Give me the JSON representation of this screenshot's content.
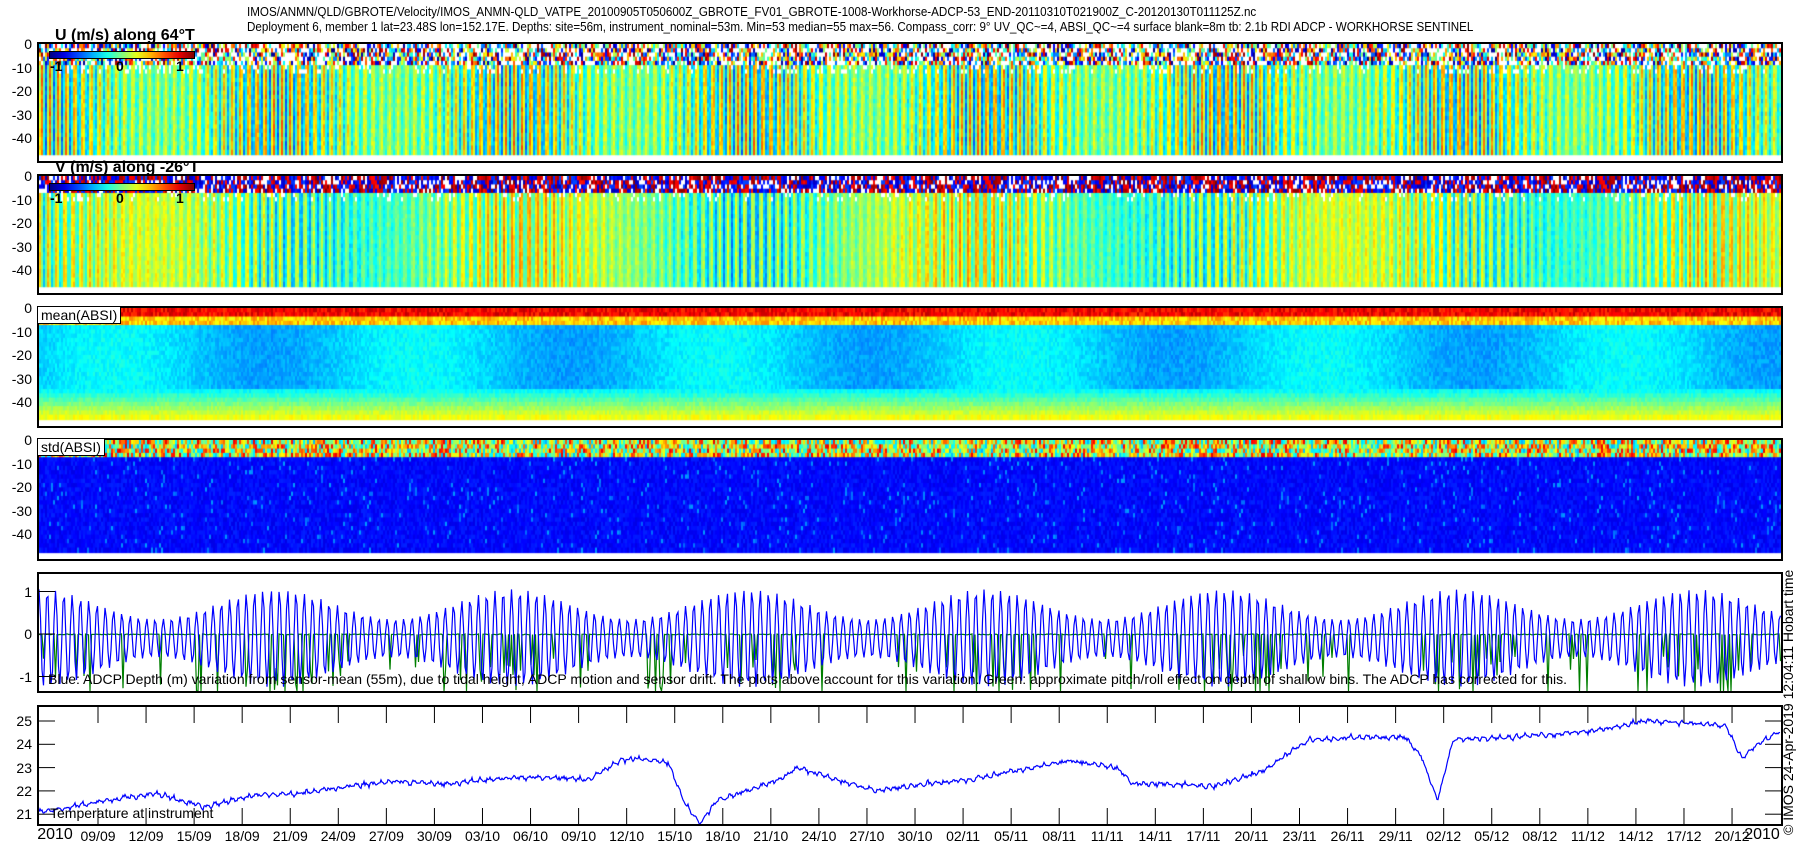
{
  "title": {
    "line1": "IMOS/ANMN/QLD/GBROTE/Velocity/IMOS_ANMN-QLD_VATPE_20100905T050600Z_GBROTE_FV01_GBROTE-1008-Workhorse-ADCP-53_END-20110310T021900Z_C-20120130T011125Z.nc",
    "line2": "Deployment 6, member 1 lat=23.48S lon=152.17E. Depths: site=56m, instrument_nominal=53m. Min=53 median=55 max=56. Compass_corr: 9° UV_QC~=4, ABSI_QC~=4 surface blank=8m tb: 2.1b RDI ADCP - WORKHORSE SENTINEL"
  },
  "panels": {
    "u": {
      "label": "U (m/s) along 64°T",
      "colorbar_ticks": [
        "-1",
        "0",
        "1"
      ]
    },
    "v": {
      "label": "V (m/s) along -26°T",
      "colorbar_ticks": [
        "-1",
        "0",
        "1"
      ]
    },
    "mean": {
      "label": "mean(ABSI)"
    },
    "std": {
      "label": "std(ABSI)"
    },
    "depth_caption": "Blue: ADCP Depth (m) variation from sensor-mean (55m), due to tidal height, ADCP motion and sensor drift. The plots above account for this variation. Green: approximate pitch/roll effect on depth of shallow bins. The ADCP has corrected for this.",
    "temp_caption": "Temperature at instrument"
  },
  "depth_ticks": [
    "0",
    "-10",
    "-20",
    "-30",
    "-40"
  ],
  "depth_var_ticks": [
    "1",
    "0",
    "-1"
  ],
  "temp_ticks": [
    "25",
    "24",
    "23",
    "22",
    "21"
  ],
  "x_axis": {
    "year_left": "2010",
    "year_right": "2010",
    "ticks": [
      "09/09",
      "12/09",
      "15/09",
      "18/09",
      "21/09",
      "24/09",
      "27/09",
      "30/09",
      "03/10",
      "06/10",
      "09/10",
      "12/10",
      "15/10",
      "18/10",
      "21/10",
      "24/10",
      "27/10",
      "30/10",
      "02/11",
      "05/11",
      "08/11",
      "11/11",
      "14/11",
      "17/11",
      "20/11",
      "23/11",
      "26/11",
      "29/11",
      "02/12",
      "05/12",
      "08/12",
      "11/12",
      "14/12",
      "17/12",
      "20/12"
    ]
  },
  "footer": "© IMOS 24-Apr-2019 12:04:11 Hobart time",
  "colors": {
    "depth_line": "#0000ff",
    "pitch_roll_line": "#007f00",
    "temperature_line": "#0000ff",
    "colormap": "jet"
  },
  "chart_data": [
    {
      "type": "heatmap",
      "name": "U",
      "title": "U (m/s) along 64°T",
      "ylim": [
        -50,
        0
      ],
      "color_range": [
        -1,
        1
      ],
      "xrange": [
        "2010-09-05",
        "2010-12-23"
      ]
    },
    {
      "type": "heatmap",
      "name": "V",
      "title": "V (m/s) along -26°T",
      "ylim": [
        -50,
        0
      ],
      "color_range": [
        -1,
        1
      ],
      "xrange": [
        "2010-09-05",
        "2010-12-23"
      ]
    },
    {
      "type": "heatmap",
      "name": "mean(ABSI)",
      "title": "mean(ABSI)",
      "ylim": [
        -50,
        0
      ]
    },
    {
      "type": "heatmap",
      "name": "std(ABSI)",
      "title": "std(ABSI)",
      "ylim": [
        -50,
        0
      ]
    },
    {
      "type": "line",
      "name": "depth variation",
      "ylim": [
        -1.5,
        1.4
      ],
      "series": [
        "blue: ADCP depth variation (m)",
        "green: pitch/roll effect"
      ]
    },
    {
      "type": "line",
      "name": "temperature",
      "ylim": [
        20.5,
        25.7
      ],
      "x": [
        "2010-09-05",
        "2010-09-09",
        "2010-09-12",
        "2010-09-15",
        "2010-09-18",
        "2010-09-21",
        "2010-09-24",
        "2010-09-27",
        "2010-09-30",
        "2010-10-03",
        "2010-10-06",
        "2010-10-09",
        "2010-10-11",
        "2010-10-12",
        "2010-10-14",
        "2010-10-15",
        "2010-10-16",
        "2010-10-17",
        "2010-10-18",
        "2010-10-21",
        "2010-10-22",
        "2010-10-24",
        "2010-10-27",
        "2010-10-30",
        "2010-11-02",
        "2010-11-05",
        "2010-11-08",
        "2010-11-11",
        "2010-11-12",
        "2010-11-14",
        "2010-11-17",
        "2010-11-20",
        "2010-11-23",
        "2010-11-26",
        "2010-11-29",
        "2010-11-30",
        "2010-12-01",
        "2010-12-02",
        "2010-12-05",
        "2010-12-08",
        "2010-12-11",
        "2010-12-14",
        "2010-12-17",
        "2010-12-19",
        "2010-12-20",
        "2010-12-21",
        "2010-12-23"
      ],
      "y": [
        21.1,
        21.6,
        21.9,
        21.3,
        21.8,
        21.9,
        22.2,
        22.4,
        22.3,
        22.5,
        22.6,
        22.5,
        23.3,
        23.4,
        23.2,
        21.5,
        20.6,
        21.6,
        21.8,
        22.5,
        23.0,
        22.6,
        22.0,
        22.3,
        22.5,
        22.9,
        23.3,
        23.0,
        22.3,
        22.3,
        22.2,
        22.8,
        24.2,
        24.3,
        24.3,
        23.5,
        21.6,
        24.2,
        24.3,
        24.4,
        24.6,
        25.0,
        24.9,
        24.8,
        23.4,
        24.0,
        24.8
      ]
    }
  ]
}
